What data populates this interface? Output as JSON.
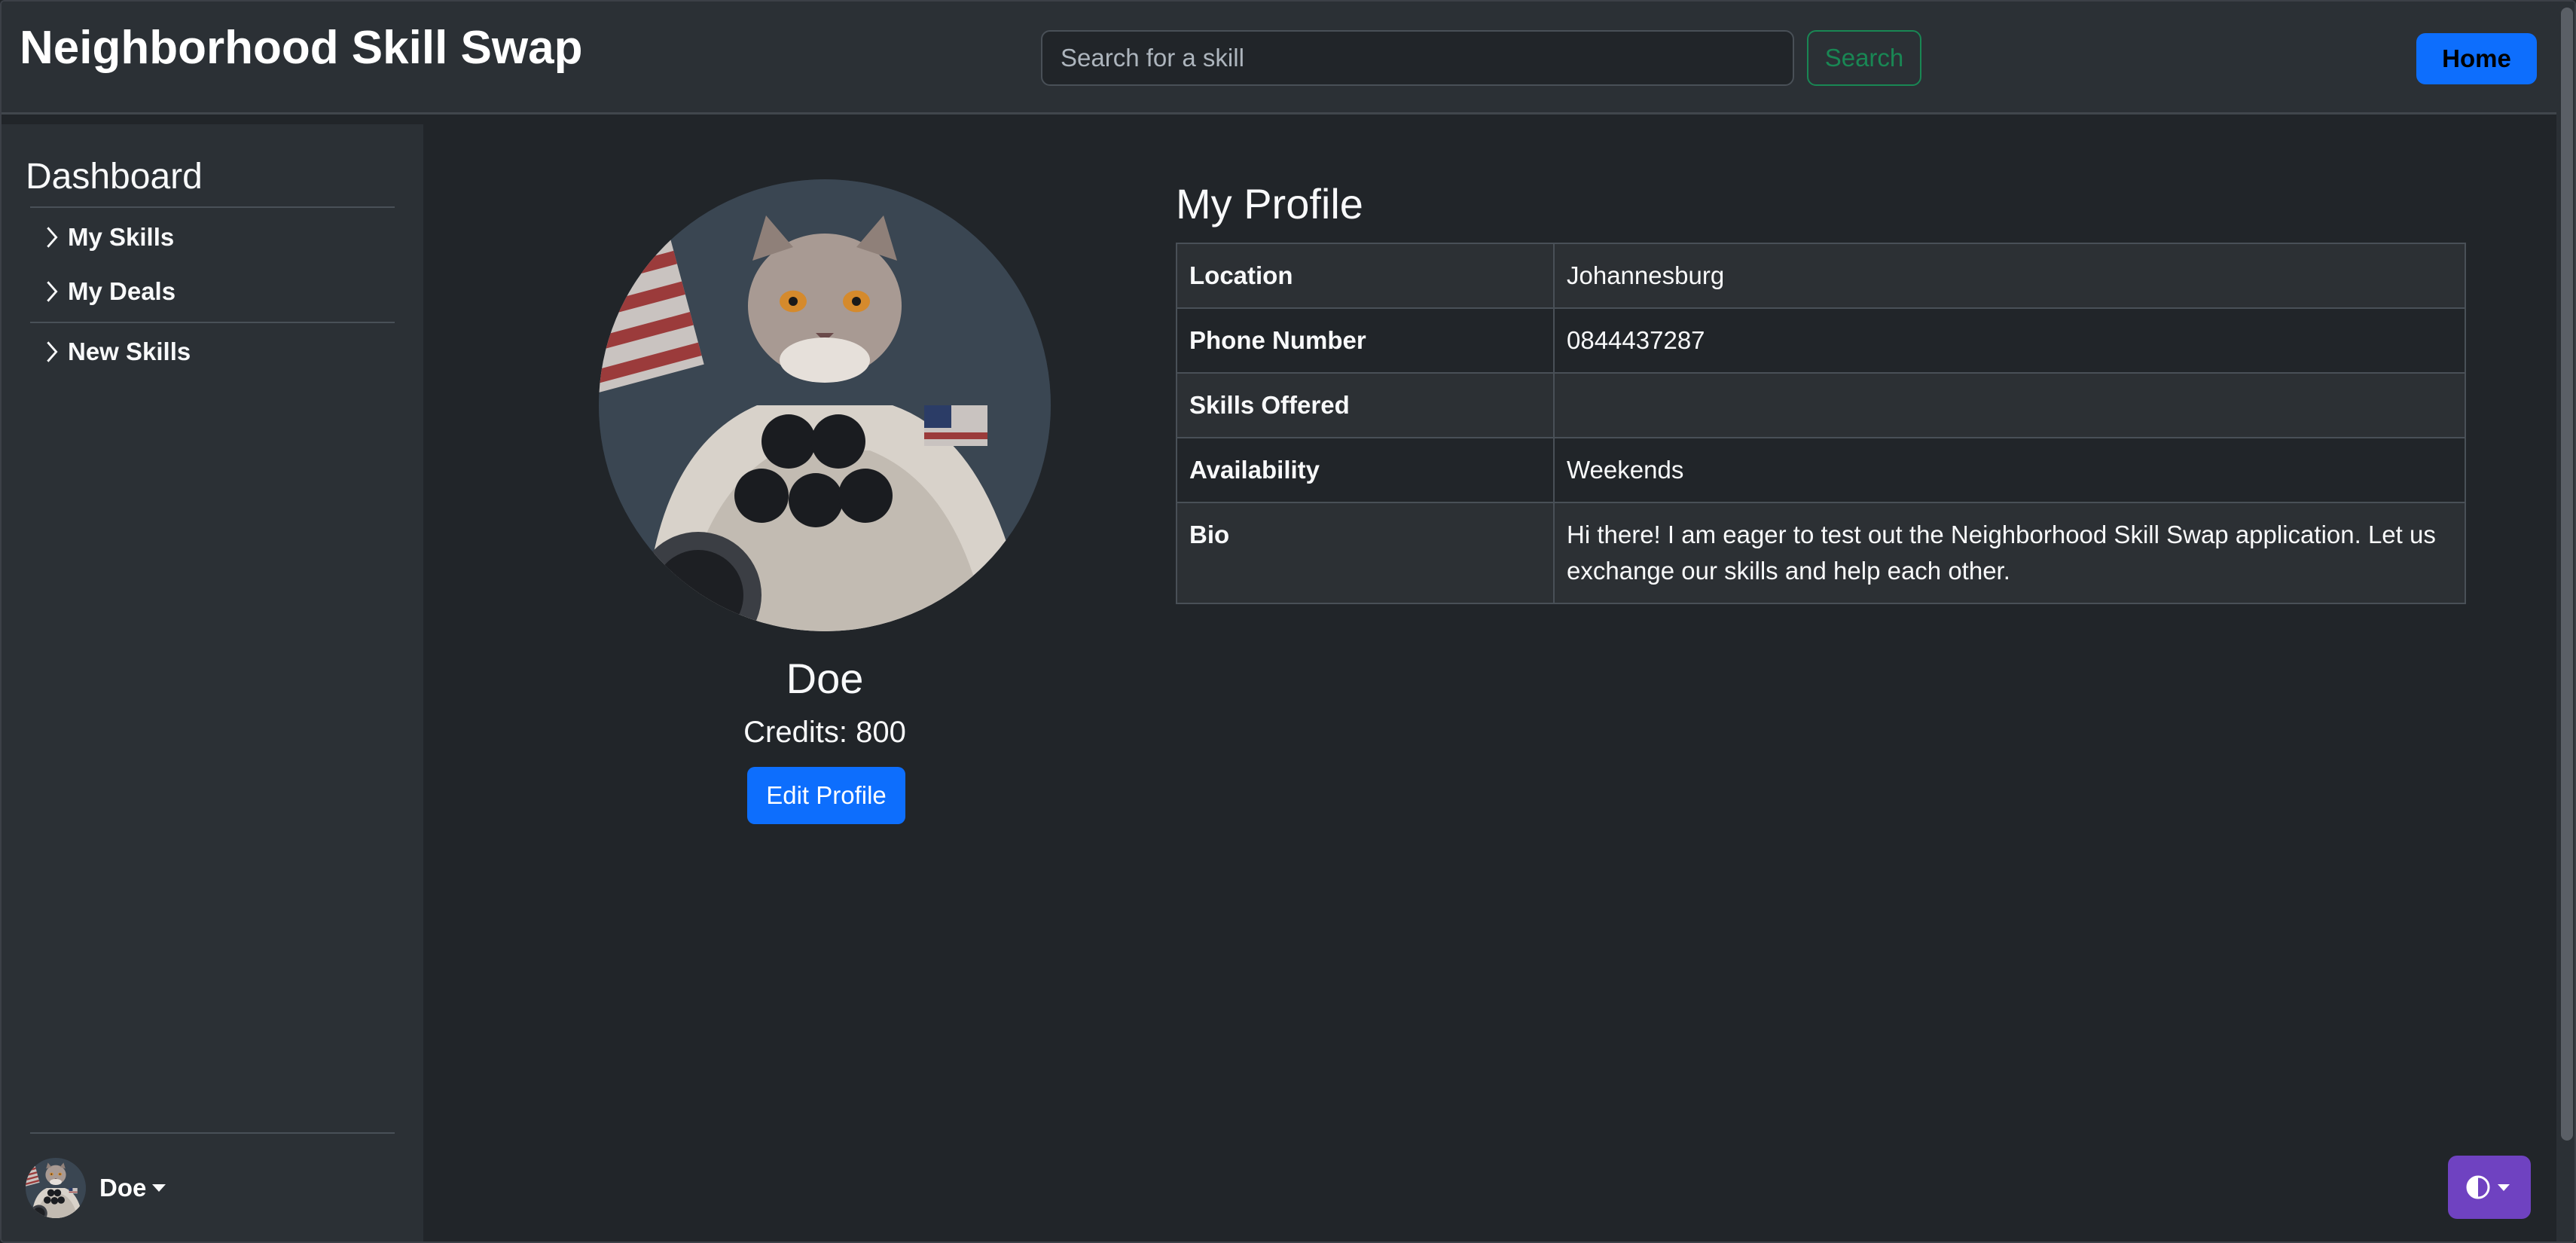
{
  "app": {
    "title": "Neighborhood Skill Swap"
  },
  "header": {
    "search_placeholder": "Search for a skill",
    "search_label": "Search",
    "home_label": "Home"
  },
  "sidebar": {
    "title": "Dashboard",
    "items": [
      {
        "label": "My Skills",
        "icon": "chevron-right-icon"
      },
      {
        "label": "My Deals",
        "icon": "chevron-right-icon"
      },
      {
        "label": "New Skills",
        "icon": "chevron-right-icon"
      }
    ],
    "user": {
      "name": "Doe",
      "icon": "caret-down-icon"
    }
  },
  "profile": {
    "name": "Doe",
    "credits": "Credits: 800",
    "edit_label": "Edit Profile"
  },
  "details": {
    "title": "My Profile",
    "rows": [
      {
        "key": "Location",
        "value": "Johannesburg"
      },
      {
        "key": "Phone Number",
        "value": "0844437287"
      },
      {
        "key": "Skills Offered",
        "value": ""
      },
      {
        "key": "Availability",
        "value": "Weekends"
      },
      {
        "key": "Bio",
        "value": "Hi there! I am eager to test out the Neighborhood Skill Swap application. Let us exchange our skills and help each other."
      }
    ]
  },
  "theme_toggle": {
    "icon": "contrast-icon"
  },
  "colors": {
    "primary": "#0d6efd",
    "success": "#198754",
    "theme_button": "#6f42c1",
    "background": "#212529",
    "surface": "#2b3035"
  }
}
